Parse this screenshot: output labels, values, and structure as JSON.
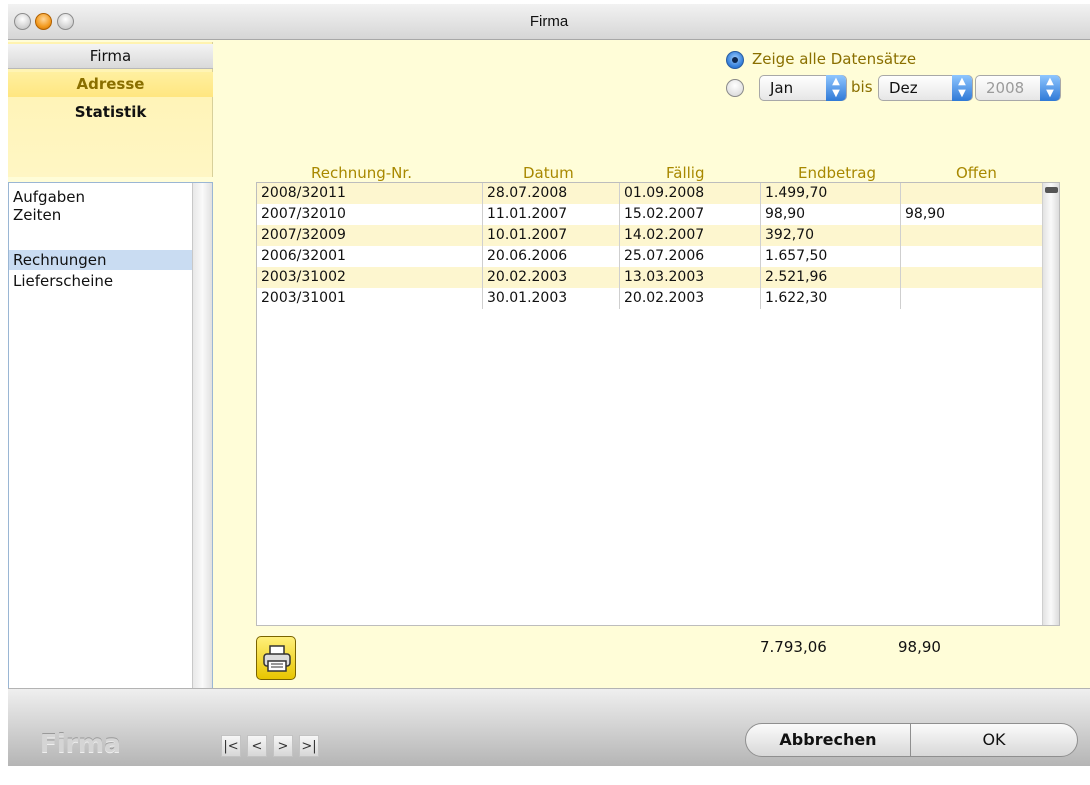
{
  "window": {
    "title": "Firma"
  },
  "side_tabs": [
    {
      "label": "Firma"
    },
    {
      "label": "Adresse"
    },
    {
      "label": "Statistik"
    }
  ],
  "side_list": [
    {
      "label": "Aufgaben"
    },
    {
      "label": "Zeiten"
    },
    {
      "label": "Rechnungen",
      "selected": true
    },
    {
      "label": "Lieferscheine"
    }
  ],
  "filter": {
    "all_label": "Zeige alle Datensätze",
    "from_month": "Jan",
    "bis_label": "bis",
    "to_month": "Dez",
    "year": "2008",
    "selected": "all"
  },
  "table": {
    "columns": [
      "Rechnung-Nr.",
      "Datum",
      "Fällig",
      "Endbetrag",
      "Offen"
    ],
    "rows": [
      [
        "2008/32011",
        "28.07.2008",
        "01.09.2008",
        "1.499,70",
        ""
      ],
      [
        "2007/32010",
        "11.01.2007",
        "15.02.2007",
        "98,90",
        "98,90"
      ],
      [
        "2007/32009",
        "10.01.2007",
        "14.02.2007",
        "392,70",
        ""
      ],
      [
        "2006/32001",
        "20.06.2006",
        "25.07.2006",
        "1.657,50",
        ""
      ],
      [
        "2003/31002",
        "20.02.2003",
        "13.03.2003",
        "2.521,96",
        ""
      ],
      [
        "2003/31001",
        "30.01.2003",
        "20.02.2003",
        "1.622,30",
        ""
      ]
    ],
    "sum_endbetrag": "7.793,06",
    "sum_offen": "98,90"
  },
  "bottom": {
    "brand": "Firma",
    "nav": [
      "|<",
      "<",
      ">",
      ">|"
    ],
    "cancel_label": "Abbrechen",
    "ok_label": "OK"
  },
  "icons": {
    "print": "printer-icon"
  },
  "colors": {
    "accent_yellow": "#fffdd8",
    "header_text": "#a88800",
    "selection": "#c9dcf2"
  }
}
